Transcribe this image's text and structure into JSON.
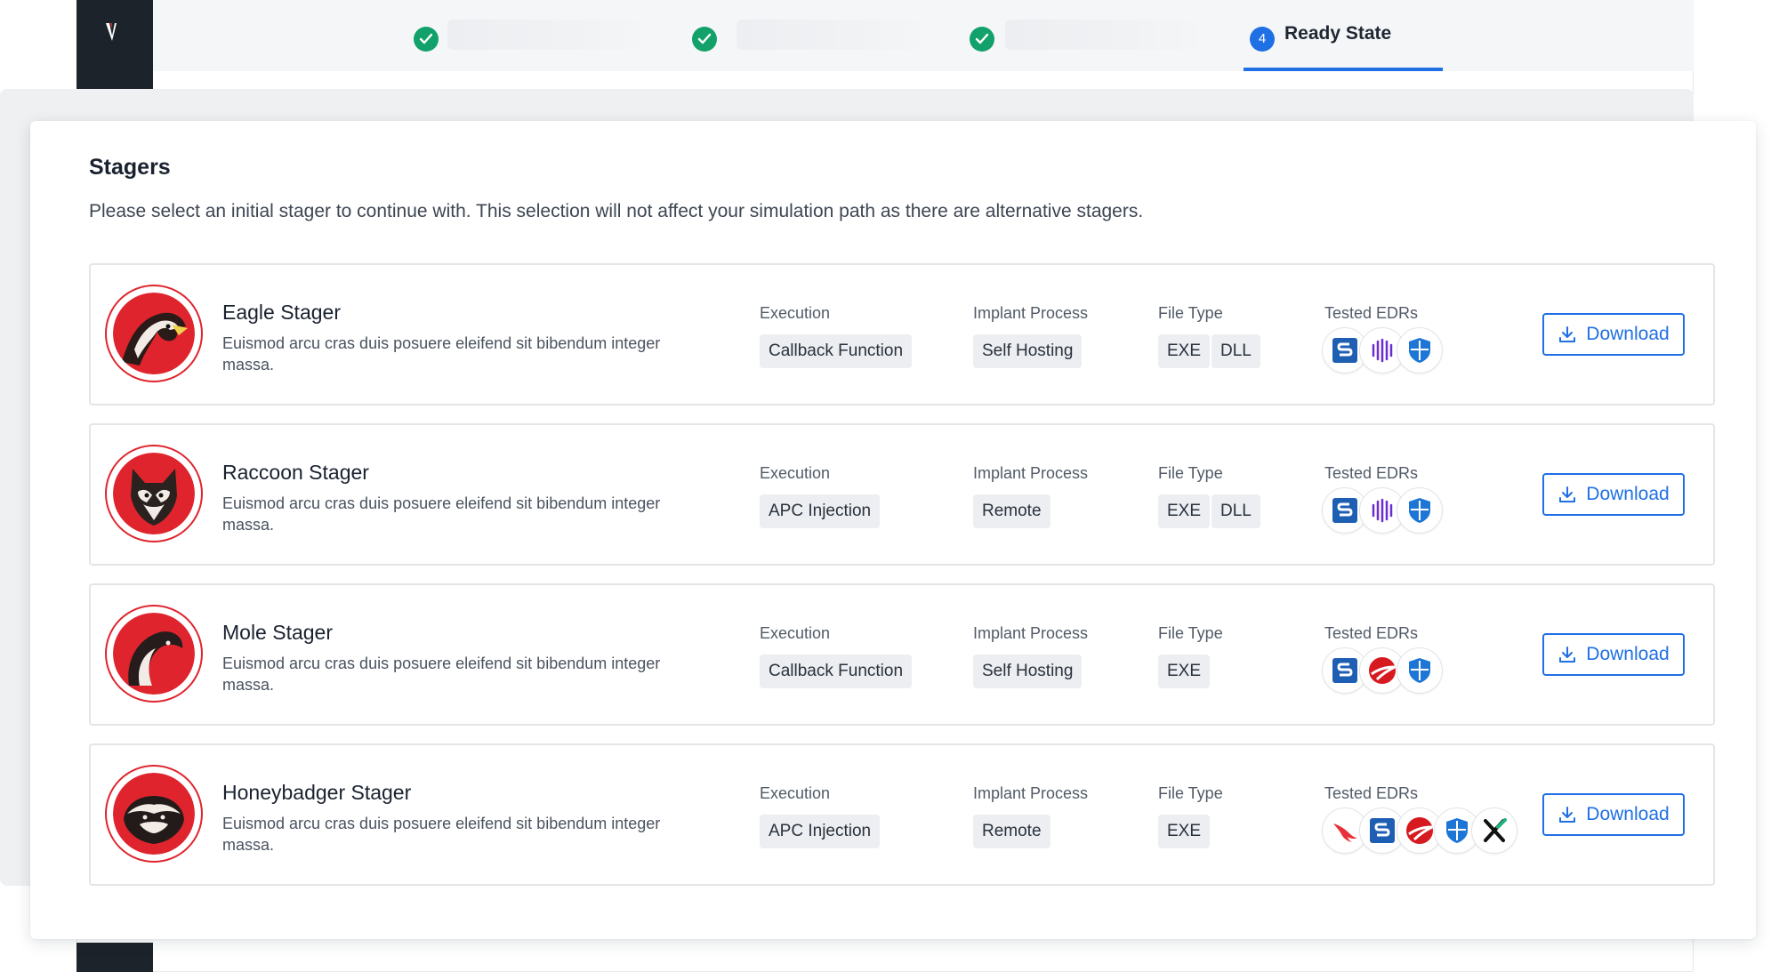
{
  "stepper": {
    "active_step_number": "4",
    "active_step_label": "Ready State",
    "completed_steps": 3
  },
  "section": {
    "title": "Stagers",
    "description": "Please select an initial stager to continue with. This selection will not affect your simulation path as there are alternative stagers."
  },
  "column_labels": {
    "execution": "Execution",
    "implant": "Implant Process",
    "filetype": "File Type",
    "edrs": "Tested EDRs"
  },
  "stagers": [
    {
      "name": "Eagle Stager",
      "description": "Euismod arcu cras duis posuere eleifend sit bibendum integer massa.",
      "avatar_icon": "eagle-icon",
      "execution": "Callback Function",
      "implant": "Self Hosting",
      "file_types": [
        "EXE",
        "DLL"
      ],
      "edrs": [
        "sentinelone-icon",
        "cybereason-icon",
        "defender-icon"
      ],
      "download_label": "Download"
    },
    {
      "name": "Raccoon Stager",
      "description": "Euismod arcu cras duis posuere eleifend sit bibendum integer massa.",
      "avatar_icon": "raccoon-icon",
      "execution": "APC Injection",
      "implant": "Remote",
      "file_types": [
        "EXE",
        "DLL"
      ],
      "edrs": [
        "sentinelone-icon",
        "cybereason-icon",
        "defender-icon"
      ],
      "download_label": "Download"
    },
    {
      "name": "Mole Stager",
      "description": "Euismod arcu cras duis posuere eleifend sit bibendum integer massa.",
      "avatar_icon": "mole-icon",
      "execution": "Callback Function",
      "implant": "Self Hosting",
      "file_types": [
        "EXE"
      ],
      "edrs": [
        "sentinelone-icon",
        "trendmicro-icon",
        "defender-icon"
      ],
      "download_label": "Download"
    },
    {
      "name": "Honeybadger Stager",
      "description": "Euismod arcu cras duis posuere eleifend sit bibendum integer massa.",
      "avatar_icon": "honeybadger-icon",
      "execution": "APC Injection",
      "implant": "Remote",
      "file_types": [
        "EXE"
      ],
      "edrs": [
        "crowdstrike-icon",
        "sentinelone-icon",
        "trendmicro-icon",
        "defender-icon",
        "cortex-xdr-icon"
      ],
      "download_label": "Download"
    }
  ],
  "colors": {
    "accent": "#1f6fe5",
    "success": "#12a16b",
    "brand_red": "#e0242d"
  }
}
